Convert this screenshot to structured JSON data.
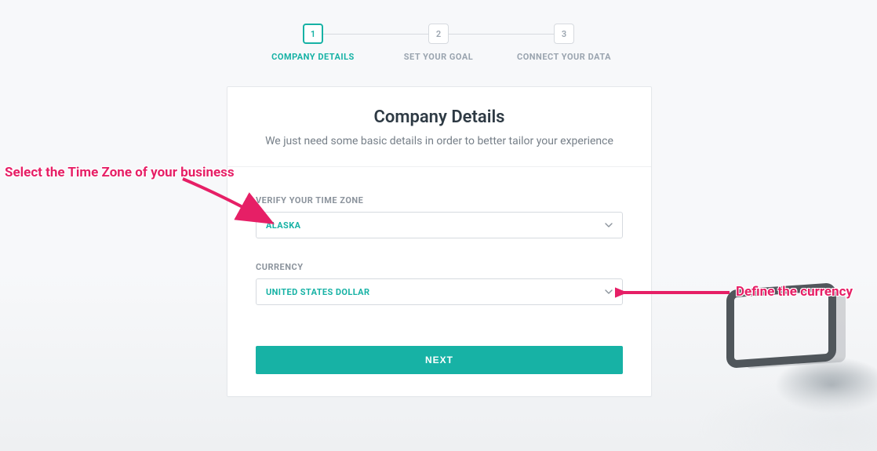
{
  "stepper": {
    "steps": [
      {
        "num": "1",
        "label": "COMPANY DETAILS",
        "state": "active"
      },
      {
        "num": "2",
        "label": "SET YOUR GOAL",
        "state": "inactive"
      },
      {
        "num": "3",
        "label": "CONNECT YOUR DATA",
        "state": "inactive"
      }
    ]
  },
  "card": {
    "title": "Company Details",
    "subtitle": "We just need some basic details in order to better tailor your experience",
    "timezone_label": "VERIFY YOUR TIME ZONE",
    "timezone_value": "ALASKA",
    "currency_label": "CURRENCY",
    "currency_value": "UNITED STATES DOLLAR",
    "next_label": "NEXT"
  },
  "annotations": {
    "timezone_note": "Select the Time Zone of your business",
    "currency_note": "Define the currency"
  },
  "colors": {
    "accent": "#17b2a5",
    "annotation": "#e61f66"
  }
}
